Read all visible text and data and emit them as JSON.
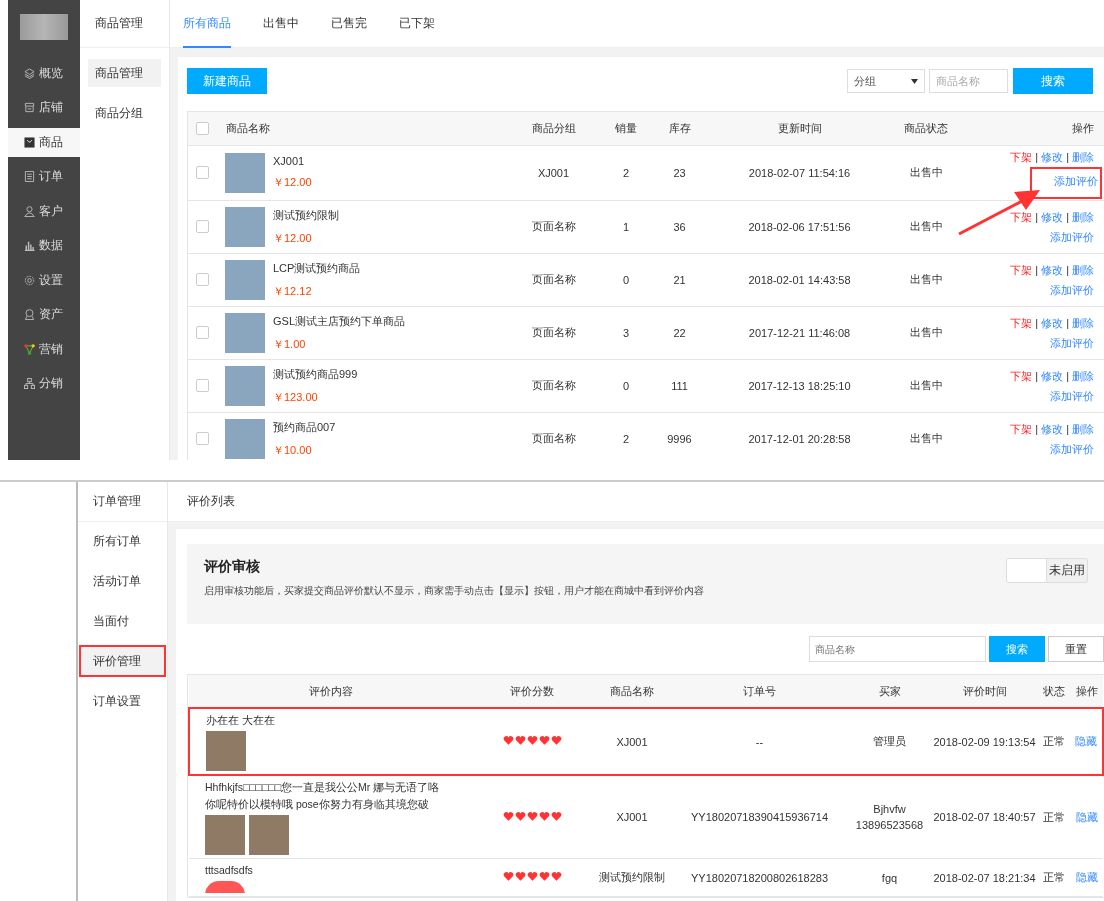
{
  "sidebar": {
    "items": [
      {
        "label": "概览",
        "kind": "layers",
        "selected": false
      },
      {
        "label": "店铺",
        "kind": "store",
        "selected": false
      },
      {
        "label": "商品",
        "kind": "bag",
        "selected": true
      },
      {
        "label": "订单",
        "kind": "clipboard",
        "selected": false
      },
      {
        "label": "客户",
        "kind": "person",
        "selected": false
      },
      {
        "label": "数据",
        "kind": "bars",
        "selected": false
      },
      {
        "label": "设置",
        "kind": "gear",
        "selected": false
      },
      {
        "label": "资产",
        "kind": "medal",
        "selected": false
      },
      {
        "label": "营销",
        "kind": "network",
        "selected": false
      },
      {
        "label": "分销",
        "kind": "hierarchy",
        "selected": false
      }
    ]
  },
  "goods": {
    "subnav": {
      "title": "商品管理",
      "items": [
        {
          "label": "商品管理",
          "selected": true
        },
        {
          "label": "商品分组",
          "selected": false
        }
      ]
    },
    "tabs": [
      {
        "label": "所有商品",
        "selected": true
      },
      {
        "label": "出售中",
        "selected": false
      },
      {
        "label": "已售完",
        "selected": false
      },
      {
        "label": "已下架",
        "selected": false
      }
    ],
    "new_button": "新建商品",
    "group_select": {
      "value": "分组"
    },
    "search": {
      "placeholder": "商品名称",
      "button": "搜索"
    },
    "table": {
      "all_checked": false,
      "columns": [
        "商品名称",
        "商品分组",
        "销量",
        "库存",
        "更新时间",
        "商品状态",
        "操作"
      ],
      "rows": [
        {
          "checked": false,
          "name": "XJ001",
          "price": "￥12.00",
          "group": "XJ001",
          "sales": "2",
          "stock": "23",
          "updated": "2018-02-07 11:54:16",
          "status": "出售中",
          "actions": [
            {
              "label": "下架",
              "kind": "danger"
            },
            {
              "label": "|",
              "kind": "separator"
            },
            {
              "label": "修改",
              "kind": "link"
            },
            {
              "label": "|",
              "kind": "separator"
            },
            {
              "label": "删除",
              "kind": "link"
            }
          ],
          "add_review": "添加评价",
          "annotated": true
        },
        {
          "checked": false,
          "name": "测试预约限制",
          "price": "￥12.00",
          "group": "页面名称",
          "sales": "1",
          "stock": "36",
          "updated": "2018-02-06 17:51:56",
          "status": "出售中",
          "actions": [
            {
              "label": "下架",
              "kind": "danger"
            },
            {
              "label": "|",
              "kind": "separator"
            },
            {
              "label": "修改",
              "kind": "link"
            },
            {
              "label": "|",
              "kind": "separator"
            },
            {
              "label": "删除",
              "kind": "link"
            }
          ],
          "add_review": "添加评价",
          "annotated": false
        },
        {
          "checked": false,
          "name": "LCP测试预约商品",
          "price": "￥12.12",
          "group": "页面名称",
          "sales": "0",
          "stock": "21",
          "updated": "2018-02-01 14:43:58",
          "status": "出售中",
          "actions": [
            {
              "label": "下架",
              "kind": "danger"
            },
            {
              "label": "|",
              "kind": "separator"
            },
            {
              "label": "修改",
              "kind": "link"
            },
            {
              "label": "|",
              "kind": "separator"
            },
            {
              "label": "删除",
              "kind": "link"
            }
          ],
          "add_review": "添加评价",
          "annotated": false
        },
        {
          "checked": false,
          "name": "GSL测试主店预约下单商品",
          "price": "￥1.00",
          "group": "页面名称",
          "sales": "3",
          "stock": "22",
          "updated": "2017-12-21 11:46:08",
          "status": "出售中",
          "actions": [
            {
              "label": "下架",
              "kind": "danger"
            },
            {
              "label": "|",
              "kind": "separator"
            },
            {
              "label": "修改",
              "kind": "link"
            },
            {
              "label": "|",
              "kind": "separator"
            },
            {
              "label": "删除",
              "kind": "link"
            }
          ],
          "add_review": "添加评价",
          "annotated": false
        },
        {
          "checked": false,
          "name": "测试预约商品999",
          "price": "￥123.00",
          "group": "页面名称",
          "sales": "0",
          "stock": "111",
          "updated": "2017-12-13 18:25:10",
          "status": "出售中",
          "actions": [
            {
              "label": "下架",
              "kind": "danger"
            },
            {
              "label": "|",
              "kind": "separator"
            },
            {
              "label": "修改",
              "kind": "link"
            },
            {
              "label": "|",
              "kind": "separator"
            },
            {
              "label": "删除",
              "kind": "link"
            }
          ],
          "add_review": "添加评价",
          "annotated": false
        },
        {
          "checked": false,
          "name": "预约商品007",
          "price": "￥10.00",
          "group": "页面名称",
          "sales": "2",
          "stock": "9996",
          "updated": "2017-12-01 20:28:58",
          "status": "出售中",
          "actions": [
            {
              "label": "下架",
              "kind": "danger"
            },
            {
              "label": "|",
              "kind": "separator"
            },
            {
              "label": "修改",
              "kind": "link"
            },
            {
              "label": "|",
              "kind": "separator"
            },
            {
              "label": "删除",
              "kind": "link"
            }
          ],
          "add_review": "添加评价",
          "annotated": false
        }
      ]
    }
  },
  "reviews": {
    "subnav": {
      "title": "订单管理",
      "items": [
        {
          "label": "所有订单",
          "selected": false,
          "annotated": false
        },
        {
          "label": "活动订单",
          "selected": false,
          "annotated": false
        },
        {
          "label": "当面付",
          "selected": false,
          "annotated": false
        },
        {
          "label": "评价管理",
          "selected": true,
          "annotated": true
        },
        {
          "label": "订单设置",
          "selected": false,
          "annotated": false
        }
      ]
    },
    "page_title": "评价列表",
    "audit": {
      "title": "评价审核",
      "description": "启用审核功能后，买家提交商品评价默认不显示，商家需手动点击【显示】按钮，用户才能在商城中看到评价内容",
      "toggle": {
        "on": false,
        "label": "未启用"
      }
    },
    "search": {
      "placeholder": "商品名称",
      "button": "搜索",
      "reset": "重置"
    },
    "table": {
      "columns": [
        "评价内容",
        "评价分数",
        "商品名称",
        "订单号",
        "买家",
        "评价时间",
        "状态",
        "操作"
      ],
      "rows": [
        {
          "content": "办在在 大在在",
          "images": [
            {
              "kind": "photo"
            }
          ],
          "stars": 5,
          "product": "XJ001",
          "order": "--",
          "buyer": "管理员",
          "time": "2018-02-09 19:13:54",
          "status": "正常",
          "action": "隐藏",
          "annotated": true
        },
        {
          "content": "Hhfhkjfs□□□□□□您一直是我公公Mr 娜与无语了咯你呢特价以模特哦 pose你努力有身临其境您破",
          "images": [
            {
              "kind": "photo"
            },
            {
              "kind": "photo"
            }
          ],
          "stars": 5,
          "product": "XJ001",
          "order": "YY18020718390415936714",
          "buyer": "Bjhvfw",
          "buyer_phone": "13896523568",
          "time": "2018-02-07 18:40:57",
          "status": "正常",
          "action": "隐藏",
          "annotated": false
        },
        {
          "content": "tttsadfsdfs",
          "images": [
            {
              "kind": "heart"
            }
          ],
          "stars": 5,
          "product": "测试预约限制",
          "order": "YY18020718200802618283",
          "buyer": "fgq",
          "time": "2018-02-07 18:21:34",
          "status": "正常",
          "action": "隐藏",
          "annotated": false
        }
      ]
    }
  }
}
